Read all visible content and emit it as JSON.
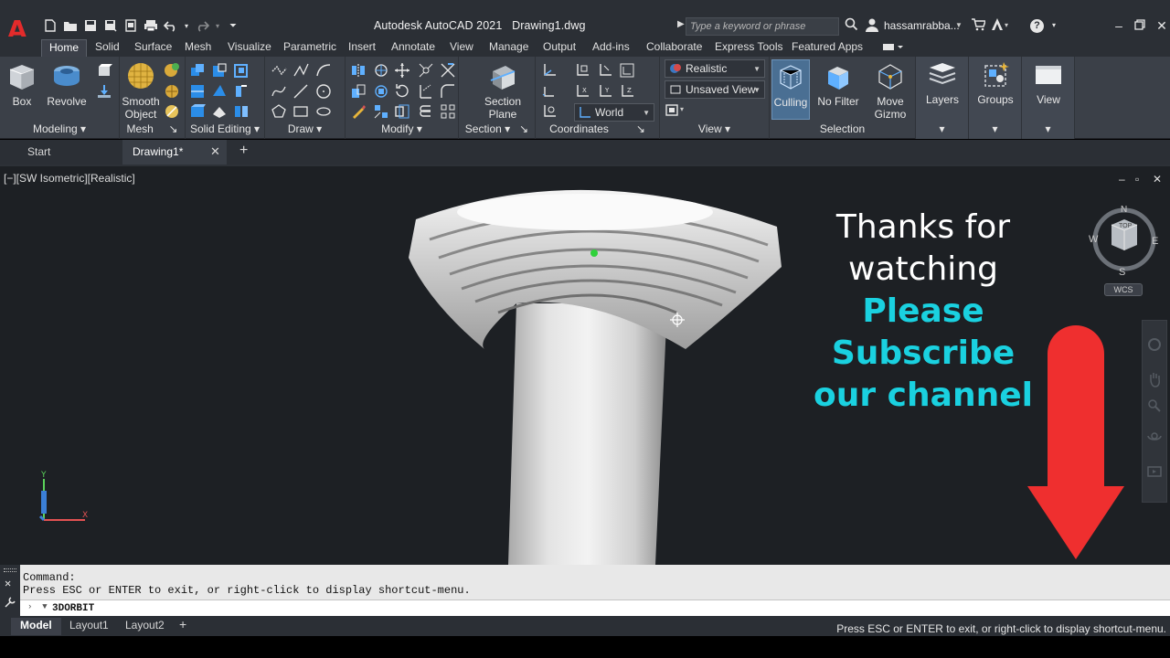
{
  "titlebar": {
    "app_name": "Autodesk AutoCAD 2021",
    "file_name": "Drawing1.dwg",
    "search_placeholder": "Type a keyword or phrase",
    "user_name": "hassamrabba..."
  },
  "ribbon_tabs": [
    "Home",
    "Solid",
    "Surface",
    "Mesh",
    "Visualize",
    "Parametric",
    "Insert",
    "Annotate",
    "View",
    "Manage",
    "Output",
    "Add-ins",
    "Collaborate",
    "Express Tools",
    "Featured Apps"
  ],
  "ribbon": {
    "modeling": {
      "label": "Modeling",
      "box": "Box",
      "revolve": "Revolve"
    },
    "mesh": {
      "label": "Mesh",
      "smooth1": "Smooth",
      "smooth2": "Object"
    },
    "solid_editing": {
      "label": "Solid Editing"
    },
    "draw": {
      "label": "Draw"
    },
    "modify": {
      "label": "Modify"
    },
    "section": {
      "label": "Section",
      "btn1": "Section",
      "btn2": "Plane"
    },
    "coordinates": {
      "label": "Coordinates",
      "ucs": "World"
    },
    "view": {
      "label": "View",
      "visual_style": "Realistic",
      "named_view": "Unsaved View"
    },
    "selection": {
      "label": "Selection",
      "culling": "Culling",
      "no_filter": "No Filter",
      "move_gizmo1": "Move",
      "move_gizmo2": "Gizmo"
    },
    "layers": "Layers",
    "groups": "Groups",
    "view_btn": "View"
  },
  "doc_tabs": {
    "start": "Start",
    "drawing": "Drawing1*"
  },
  "viewport": {
    "label": "[−][SW Isometric][Realistic]",
    "overlay_line1": "Thanks for",
    "overlay_line2": "watching",
    "overlay_line3": "Please Subscribe",
    "overlay_line4": "our channel",
    "viewcube": {
      "top": "TOP",
      "n": "N",
      "s": "S",
      "e": "E",
      "w": "W",
      "wcs": "WCS"
    },
    "colors": {
      "subscribe": "#1ad1e0",
      "arrow": "#ef2f2f"
    }
  },
  "command": {
    "line1": "Command:",
    "line2": "Press ESC or ENTER to exit, or right-click to display shortcut-menu.",
    "input": "3DORBIT"
  },
  "status": {
    "tabs": [
      "Model",
      "Layout1",
      "Layout2"
    ],
    "message": "Press ESC or ENTER to exit, or right-click to display shortcut-menu."
  }
}
